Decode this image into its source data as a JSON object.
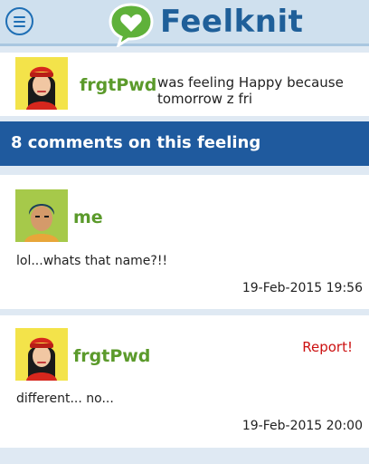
{
  "app": {
    "logo_text": "Feelknit"
  },
  "post": {
    "username": "frgtPwd",
    "feeling_text": "was feeling Happy because tomorrow z fri"
  },
  "comments_header": "8 comments on this feeling",
  "comments": [
    {
      "username": "me",
      "text": "lol...whats that name?!!",
      "timestamp": "19-Feb-2015 19:56"
    },
    {
      "username": "frgtPwd",
      "text": "different... no...",
      "timestamp": "19-Feb-2015 20:00",
      "action": "Report!"
    }
  ],
  "colors": {
    "brand_blue": "#1f5f99",
    "brand_green": "#5fb13a",
    "username_green": "#5b9a2b",
    "report_red": "#cc1111"
  },
  "icons": {
    "menu": "hamburger-menu-icon",
    "logo": "heart-speech-bubble-icon"
  }
}
